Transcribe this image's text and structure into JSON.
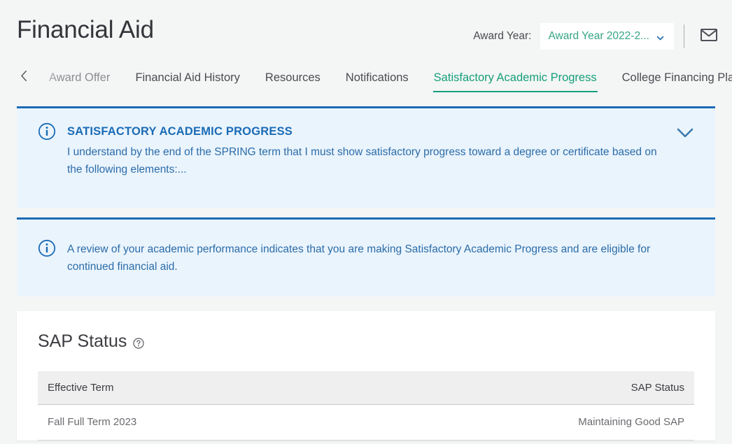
{
  "header": {
    "title": "Financial Aid",
    "award_year_label": "Award Year:",
    "award_year_value": "Award Year 2022-2...",
    "chevron_icon": "chevron-down-icon",
    "mail_icon": "envelope-icon",
    "accent_green": "#16a07a",
    "accent_blue": "#1a6bb5"
  },
  "tabs": {
    "back_icon": "chevron-left-icon",
    "items": [
      {
        "label": "Award Offer",
        "active": false
      },
      {
        "label": "Financial Aid History",
        "active": false
      },
      {
        "label": "Resources",
        "active": false
      },
      {
        "label": "Notifications",
        "active": false
      },
      {
        "label": "Satisfactory Academic Progress",
        "active": true
      },
      {
        "label": "College Financing Plan",
        "active": false
      }
    ]
  },
  "panels": [
    {
      "icon": "info-circle-icon",
      "title": "SATISFACTORY ACADEMIC PROGRESS",
      "text": "I understand by the end of the SPRING term that I must show satisfactory progress toward a degree or certificate based on the following elements:...",
      "chevron_icon": "chevron-down-icon"
    },
    {
      "icon": "info-circle-icon",
      "title": "",
      "text": "A review of your academic performance indicates that you are making Satisfactory Academic Progress and are eligible for continued financial aid."
    }
  ],
  "sap_card": {
    "title": "SAP Status",
    "help_icon": "help-circle-icon",
    "table": {
      "columns": [
        "Effective Term",
        "SAP Status"
      ],
      "rows": [
        {
          "effective_term": "Fall Full Term 2023",
          "sap_status": "Maintaining Good SAP"
        }
      ]
    }
  }
}
